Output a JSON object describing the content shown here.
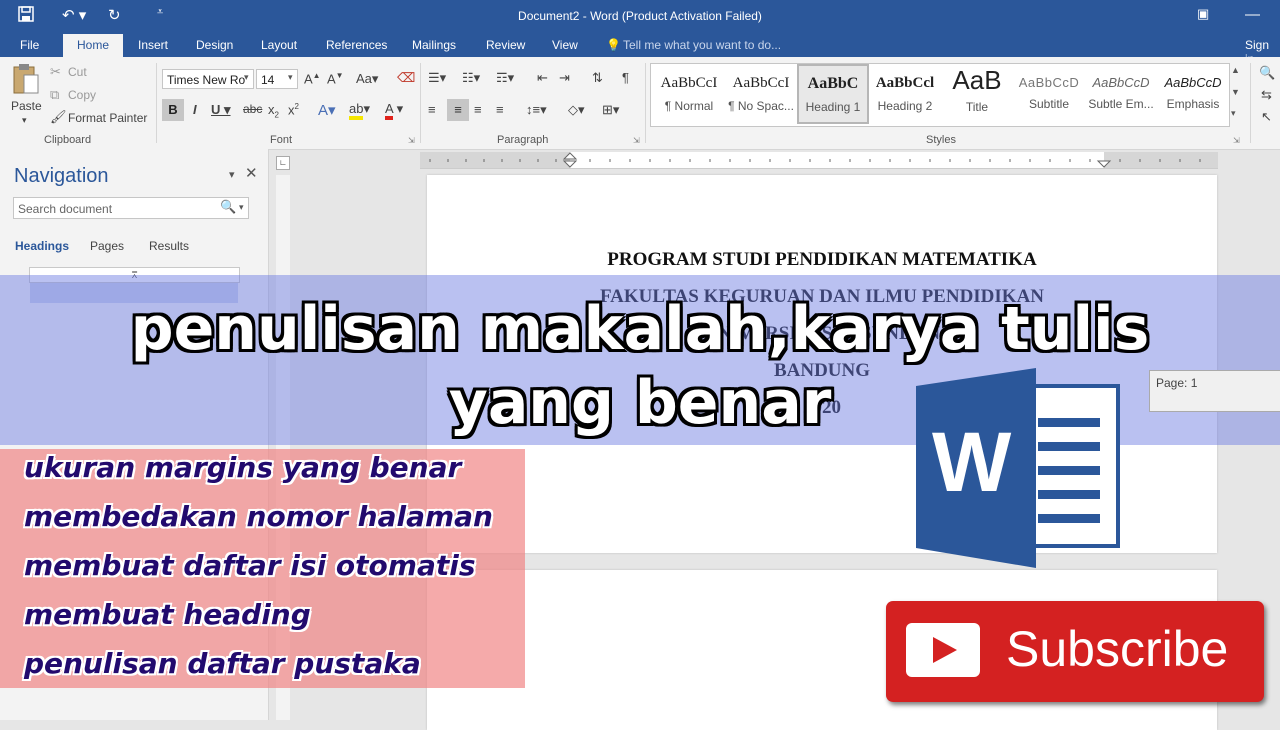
{
  "title_bar": {
    "title": "Document2 - Word (Product Activation Failed)"
  },
  "tabs": [
    "File",
    "Home",
    "Insert",
    "Design",
    "Layout",
    "References",
    "Mailings",
    "Review",
    "View"
  ],
  "tell_me": "Tell me what you want to do...",
  "sign_in": "Sign in",
  "clipboard": {
    "paste": "Paste",
    "cut": "Cut",
    "copy": "Copy",
    "format_painter": "Format Painter",
    "group": "Clipboard"
  },
  "font": {
    "name": "Times New Ro",
    "size": "14",
    "group": "Font"
  },
  "paragraph": {
    "group": "Paragraph"
  },
  "styles": {
    "group": "Styles",
    "items": [
      {
        "preview": "AaBbCcI",
        "name": "¶ Normal"
      },
      {
        "preview": "AaBbCcI",
        "name": "¶ No Spac..."
      },
      {
        "preview": "AaBbC",
        "name": "Heading 1"
      },
      {
        "preview": "AaBbCcl",
        "name": "Heading 2"
      },
      {
        "preview": "AaB",
        "name": "Title"
      },
      {
        "preview": "AaBbCcD",
        "name": "Subtitle"
      },
      {
        "preview": "AaBbCcD",
        "name": "Subtle Em..."
      },
      {
        "preview": "AaBbCcD",
        "name": "Emphasis"
      }
    ]
  },
  "navigation": {
    "title": "Navigation",
    "search_placeholder": "Search document",
    "tabs": [
      "Headings",
      "Pages",
      "Results"
    ]
  },
  "document": {
    "lines": [
      "PROGRAM STUDI PENDIDIKAN MATEMATIKA",
      "FAKULTAS KEGURUAN DAN ILMU PENDIDIKAN",
      "UNIVERSITAS PASUNDAN",
      "BANDUNG",
      "2020"
    ]
  },
  "page_tooltip": "Page: 1",
  "overlay": {
    "headline_1": "penulisan makalah,karya tulis",
    "headline_2": "yang benar",
    "topics": [
      "ukuran margins yang benar",
      "membedakan nomor halaman",
      "membuat daftar isi otomatis",
      "membuat heading",
      "penulisan daftar pustaka"
    ]
  },
  "subscribe": "Subscribe",
  "word_logo_letter": "W",
  "colors": {
    "word_blue": "#2b579a",
    "subscribe_red": "#d42121",
    "topic_text": "#220a6e"
  }
}
